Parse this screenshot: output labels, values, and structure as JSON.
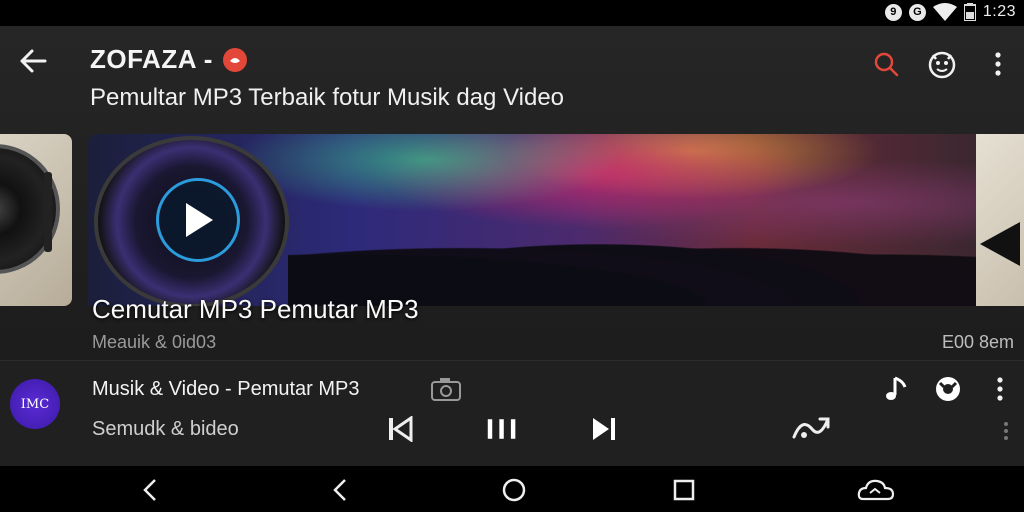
{
  "status_bar": {
    "badge_1": "9",
    "badge_2": "G",
    "time": "1:23"
  },
  "header": {
    "app_title": "ZOFAZA -",
    "subtitle": "Pemultar MP3 Terbaik fotur Musik dag Video",
    "icons": [
      "back-arrow-icon",
      "search-icon",
      "face-icon",
      "more-vert-icon"
    ],
    "accent_color": "#e2473a"
  },
  "carousel": {
    "featured_title": "Cemutar MP3 Pemutar MP3",
    "meta_left": "Meauik & 0id03",
    "meta_right": "E00 8em"
  },
  "now_playing": {
    "avatar_text": "IMC",
    "title": "Musik & Video - Pemutar MP3",
    "subtitle": "Semudk & bideo",
    "controls": [
      "previous-icon",
      "pause-icon",
      "next-icon",
      "shuffle-icon"
    ],
    "avatar_color": "#4a24c4"
  },
  "nav_bar": {
    "items": [
      "back-icon",
      "back-icon",
      "home-icon",
      "recents-icon",
      "cloud-icon"
    ]
  }
}
